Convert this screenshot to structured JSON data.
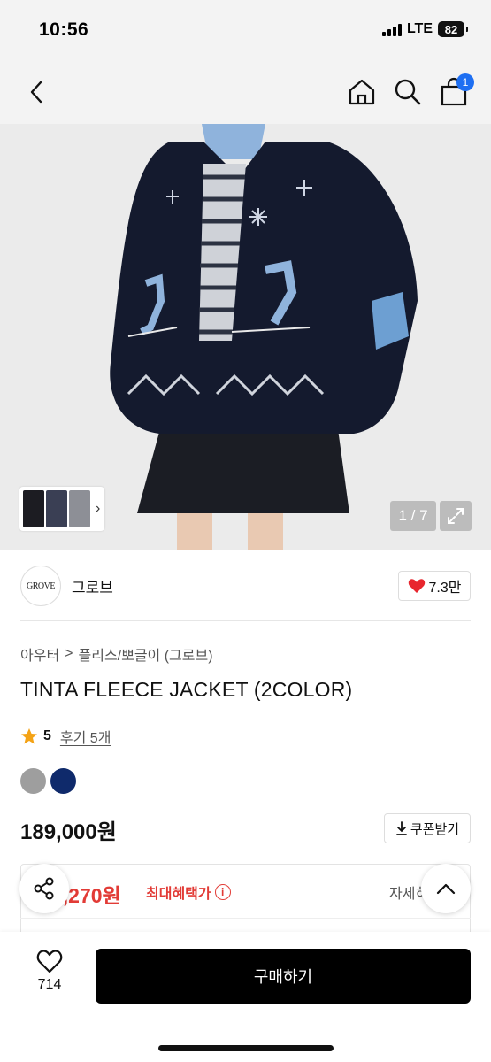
{
  "status_bar": {
    "time": "10:56",
    "network": "LTE",
    "battery": "82"
  },
  "nav": {
    "cart_count": "1",
    "icons": [
      "chevron-left-icon",
      "home-icon",
      "search-icon",
      "shopping-bag-icon"
    ]
  },
  "gallery": {
    "page_indicator": "1 / 7",
    "thumb_arrow": "›"
  },
  "brand": {
    "logo_text": "GROVE",
    "name": "그로브",
    "likes": "7.3만"
  },
  "breadcrumb": {
    "category": "아우터",
    "separator": ">",
    "subcategory": "플리스/뽀글이 (그로브)"
  },
  "product": {
    "title": "TINTA FLEECE JACKET (2COLOR)",
    "rating": "5",
    "reviews": "후기 5개",
    "colors": [
      "#9e9e9e",
      "#0f2a6b"
    ],
    "price": "189,000원",
    "coupon_label": "쿠폰받기"
  },
  "benefit": {
    "price": "3,270원",
    "label": "최대혜택가",
    "info": "i",
    "detail": "자세히"
  },
  "bottom": {
    "wishlist_count": "714",
    "buy_label": "구매하기"
  },
  "theme": {
    "accent": "#e23b36",
    "badge": "#1e6ff2",
    "heart": "#e8262e"
  }
}
